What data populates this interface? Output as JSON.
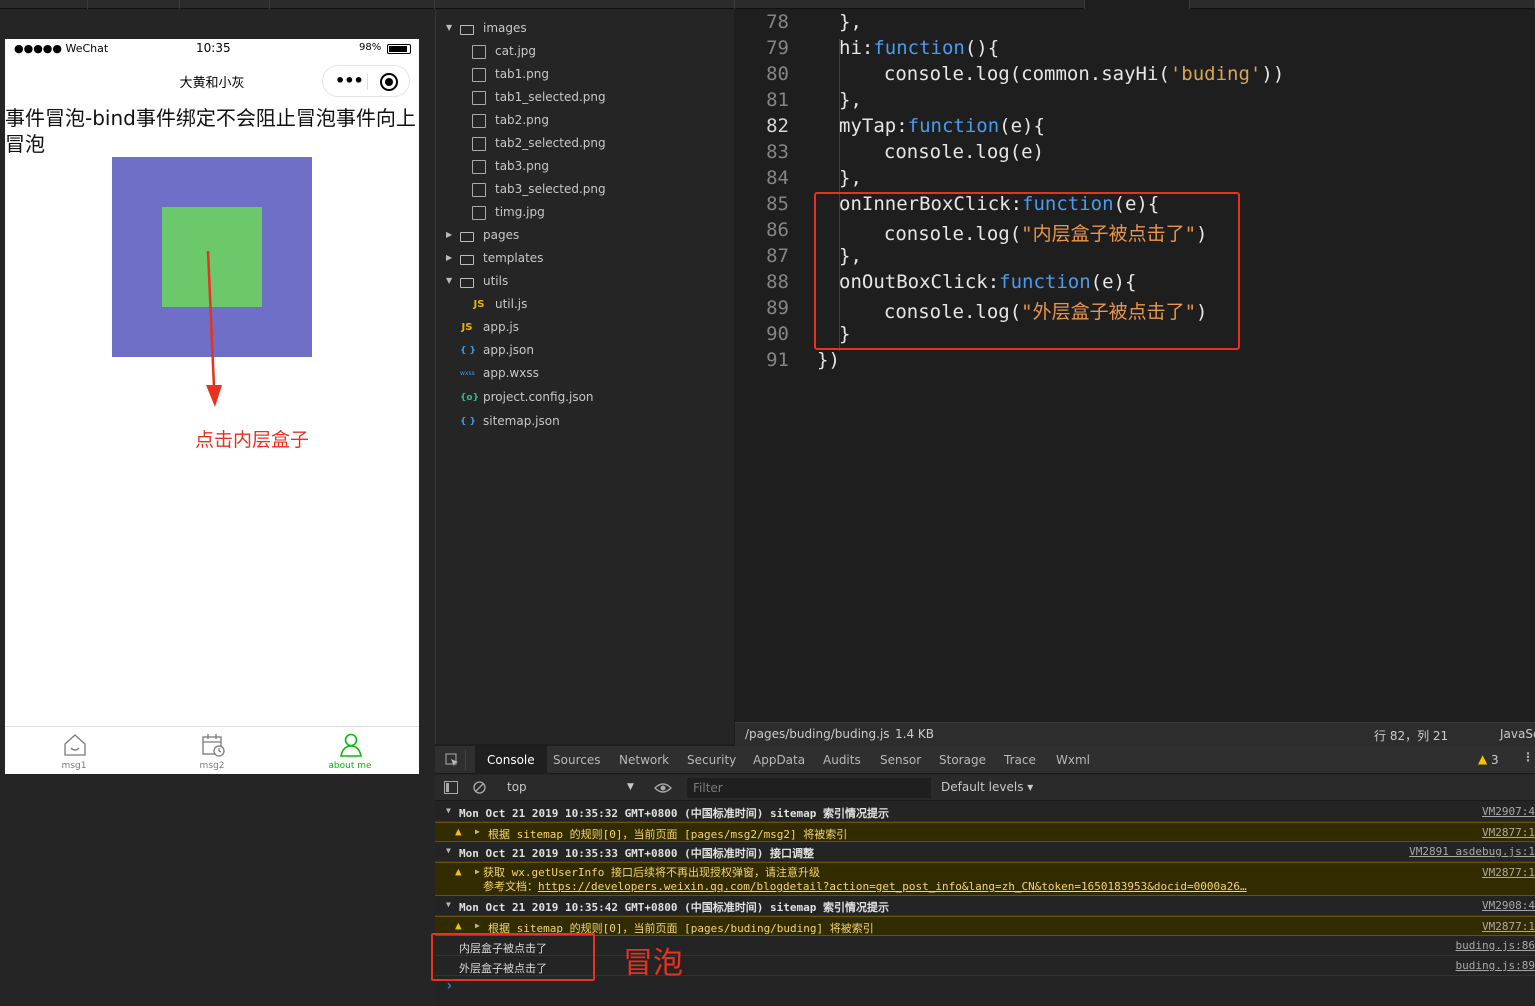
{
  "simulator": {
    "status": {
      "carrier": "●●●●● WeChat",
      "time": "10:35",
      "battery": "98%"
    },
    "nav_title": "大黄和小灰",
    "capsule_more": "•••",
    "page_text": "事件冒泡-bind事件绑定不会阻止冒泡事件向上冒泡",
    "colors": {
      "outer_box": "#6f6fc8",
      "inner_box": "#6bc86b"
    },
    "annotation": "点击内层盒子",
    "tabbar": [
      {
        "label": "msg1",
        "icon": "home-icon"
      },
      {
        "label": "msg2",
        "icon": "calendar-icon"
      },
      {
        "label": "about me",
        "icon": "user-icon",
        "active": true
      }
    ]
  },
  "file_tree": [
    {
      "name": "images",
      "type": "folder",
      "expanded": true
    },
    {
      "name": "cat.jpg",
      "type": "image"
    },
    {
      "name": "tab1.png",
      "type": "image"
    },
    {
      "name": "tab1_selected.png",
      "type": "image"
    },
    {
      "name": "tab2.png",
      "type": "image"
    },
    {
      "name": "tab2_selected.png",
      "type": "image"
    },
    {
      "name": "tab3.png",
      "type": "image"
    },
    {
      "name": "tab3_selected.png",
      "type": "image"
    },
    {
      "name": "timg.jpg",
      "type": "image"
    },
    {
      "name": "pages",
      "type": "folder",
      "expanded": false
    },
    {
      "name": "templates",
      "type": "folder",
      "expanded": false
    },
    {
      "name": "utils",
      "type": "folder",
      "expanded": true
    },
    {
      "name": "util.js",
      "type": "js"
    },
    {
      "name": "app.js",
      "type": "js"
    },
    {
      "name": "app.json",
      "type": "json"
    },
    {
      "name": "app.wxss",
      "type": "wxss"
    },
    {
      "name": "project.config.json",
      "type": "config"
    },
    {
      "name": "sitemap.json",
      "type": "json"
    }
  ],
  "editor": {
    "lines": [
      {
        "n": "78",
        "parts": [
          [
            "p",
            "},"
          ]
        ]
      },
      {
        "n": "79",
        "parts": [
          [
            "p",
            "hi:"
          ],
          [
            "kw",
            "function"
          ],
          [
            "p",
            "(){"
          ]
        ]
      },
      {
        "n": "80",
        "parts": [
          [
            "p",
            "  console.log(common.sayHi("
          ],
          [
            "s2",
            "'buding'"
          ],
          [
            "p",
            "))"
          ]
        ]
      },
      {
        "n": "81",
        "parts": [
          [
            "p",
            "},"
          ]
        ]
      },
      {
        "n": "82",
        "parts": [
          [
            "p",
            "myTap:"
          ],
          [
            "kw",
            "function"
          ],
          [
            "p",
            "(e){"
          ]
        ]
      },
      {
        "n": "83",
        "parts": [
          [
            "p",
            "  console.log(e)"
          ]
        ]
      },
      {
        "n": "84",
        "parts": [
          [
            "p",
            "},"
          ]
        ]
      },
      {
        "n": "85",
        "parts": [
          [
            "p",
            "onInnerBoxClick:"
          ],
          [
            "kw",
            "function"
          ],
          [
            "p",
            "(e){"
          ]
        ]
      },
      {
        "n": "86",
        "parts": [
          [
            "p",
            "  console.log("
          ],
          [
            "s",
            "\"内层盒子被点击了\""
          ],
          [
            "p",
            ")"
          ]
        ]
      },
      {
        "n": "87",
        "parts": [
          [
            "p",
            "},"
          ]
        ]
      },
      {
        "n": "88",
        "parts": [
          [
            "p",
            "onOutBoxClick:"
          ],
          [
            "kw",
            "function"
          ],
          [
            "p",
            "(e){"
          ]
        ]
      },
      {
        "n": "89",
        "parts": [
          [
            "p",
            "  console.log("
          ],
          [
            "s",
            "\"外层盒子被点击了\""
          ],
          [
            "p",
            ")"
          ]
        ]
      },
      {
        "n": "90",
        "parts": [
          [
            "p",
            "}"
          ]
        ]
      },
      {
        "n": "91",
        "parts": [
          [
            "p",
            "})"
          ]
        ]
      }
    ],
    "current_line": "82",
    "status": {
      "path": "/pages/buding/buding.js",
      "size": "1.4 KB",
      "cursor": "行 82，列 21",
      "lang": "JavaScript"
    }
  },
  "devtools": {
    "tabs": [
      "Console",
      "Sources",
      "Network",
      "Security",
      "AppData",
      "Audits",
      "Sensor",
      "Storage",
      "Trace",
      "Wxml"
    ],
    "active_tab": "Console",
    "warn_count": "3",
    "context": "top",
    "filter_placeholder": "Filter",
    "levels": "Default levels ▾",
    "rows": [
      {
        "kind": "group",
        "text": "Mon Oct 21 2019 10:35:32 GMT+0800 (中国标准时间) sitemap 索引情况提示",
        "src": "VM2907:4"
      },
      {
        "kind": "warn",
        "text": "根据 sitemap 的规则[0]，当前页面 [pages/msg2/msg2] 将被索引",
        "src": "VM2877:1"
      },
      {
        "kind": "group",
        "text": "Mon Oct 21 2019 10:35:33 GMT+0800 (中国标准时间) 接口调整",
        "src": "VM2891 asdebug.js:1"
      },
      {
        "kind": "warn2",
        "text": "获取 wx.getUserInfo 接口后续将不再出现授权弹窗，请注意升级",
        "text2": "参考文档：",
        "link": "https://developers.weixin.qq.com/blogdetail?action=get_post_info&lang=zh_CN&token=1650183953&docid=0000a26…",
        "src": "VM2877:1"
      },
      {
        "kind": "group",
        "text": "Mon Oct 21 2019 10:35:42 GMT+0800 (中国标准时间) sitemap 索引情况提示",
        "src": "VM2908:4"
      },
      {
        "kind": "warn",
        "text": "根据 sitemap 的规则[0]，当前页面 [pages/buding/buding] 将被索引",
        "src": "VM2877:1"
      },
      {
        "kind": "log",
        "text": "内层盒子被点击了",
        "src": "buding.js:86"
      },
      {
        "kind": "log",
        "text": "外层盒子被点击了",
        "src": "buding.js:89"
      }
    ],
    "bubble_annotation": "冒泡",
    "prompt": "›"
  }
}
